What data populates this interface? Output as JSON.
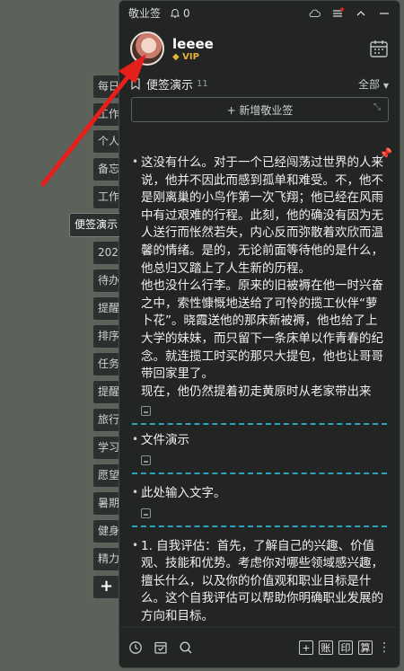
{
  "side_tabs": [
    {
      "label": "每日"
    },
    {
      "label": "工作"
    },
    {
      "label": "个人"
    },
    {
      "label": "备忘"
    },
    {
      "label": "工作"
    },
    {
      "label": "便签演示"
    },
    {
      "label": "202"
    },
    {
      "label": "待办"
    },
    {
      "label": "提醒"
    },
    {
      "label": "排序"
    },
    {
      "label": "任务"
    },
    {
      "label": "提醒"
    },
    {
      "label": "旅行"
    },
    {
      "label": "学习"
    },
    {
      "label": "愿望"
    },
    {
      "label": "暑期"
    },
    {
      "label": "健身"
    },
    {
      "label": "精力"
    }
  ],
  "side_add_label": "+",
  "titlebar": {
    "title": "敬业签",
    "notify_count": "0"
  },
  "profile": {
    "username": "leeee",
    "badge": "VIP"
  },
  "list": {
    "name": "便签演示",
    "count": "11",
    "filter": "全部"
  },
  "add_note_label": "+ 新增敬业签",
  "notes": [
    {
      "paragraphs": [
        "这没有什么。对于一个已经闯荡过世界的人来说，他并不因此而感到孤单和难受。不，他不是刚离巢的小鸟作第一次飞翔；他已经在风雨中有过艰难的行程。此刻，他的确没有因为无人送行而怅然若失，内心反而弥散着欢欣而温馨的情绪。是的，无论前面等待他的是什么，他总归又踏上了人生新的历程。",
        "他也没什么行李。原来的旧被褥在他一时兴奋之中，索性慷慨地送给了可怜的揽工伙伴“萝卜花”。晓霞送他的那床新被褥，他也给了上大学的妹妹，而只留下一条床单以作青春的纪念。就连揽工时买的那只大提包，他也让哥哥带回家里了。",
        "现在，他仍然提着初走黄原时从老家带出来"
      ]
    },
    {
      "paragraphs": [
        "文件演示"
      ]
    },
    {
      "paragraphs": [
        "此处输入文字。"
      ]
    },
    {
      "paragraphs": [
        "1. 自我评估：首先，了解自己的兴趣、价值观、技能和优势。考虑你对哪些领域感兴趣，擅长什么，以及你的价值观和职业目标是什么。这个自我评估可以帮助你明确职业发展的方向和目标。"
      ]
    }
  ],
  "bottom": {
    "btn_add": "+",
    "btn_account": "账",
    "btn_print": "印",
    "btn_calc": "算"
  },
  "colors": {
    "accent": "#2aa4bd",
    "vip": "#e6b33a",
    "arrow": "#e5201c"
  }
}
